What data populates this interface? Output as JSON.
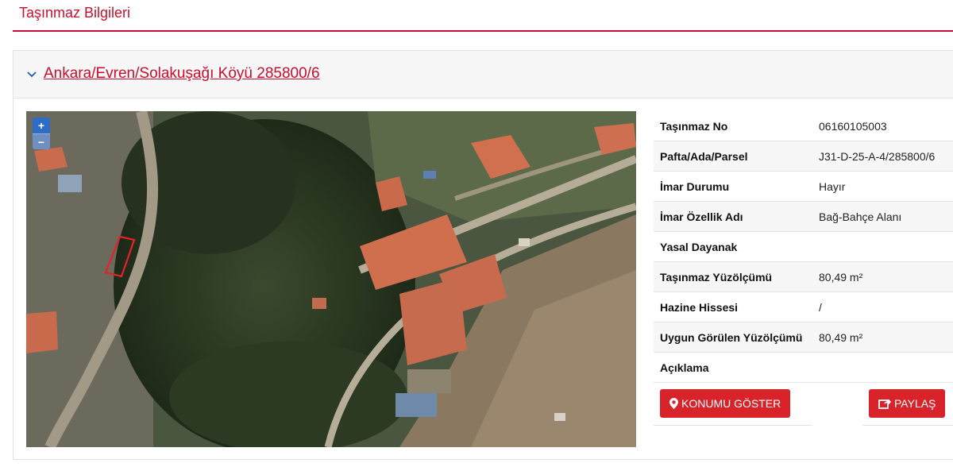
{
  "page": {
    "title": "Taşınmaz Bilgileri"
  },
  "panel": {
    "link": "Ankara/Evren/Solakuşağı Köyü 285800/6",
    "icons": {
      "chevron": "chevron-down-icon"
    }
  },
  "map": {
    "zoom_in": "+",
    "zoom_out": "−",
    "parcel_color": "#e3232c"
  },
  "info": {
    "rows": [
      {
        "label": "Taşınmaz No",
        "value": "06160105003"
      },
      {
        "label": "Pafta/Ada/Parsel",
        "value": "J31-D-25-A-4/285800/6"
      },
      {
        "label": "İmar Durumu",
        "value": "Hayır"
      },
      {
        "label": "İmar Özellik Adı",
        "value": "Bağ-Bahçe Alanı"
      },
      {
        "label": "Yasal Dayanak",
        "value": ""
      },
      {
        "label": "Taşınmaz Yüzölçümü",
        "value": "80,49 m²"
      },
      {
        "label": "Hazine Hissesi",
        "value": "/"
      },
      {
        "label": "Uygun Görülen Yüzölçümü",
        "value": "80,49 m²"
      },
      {
        "label": "Açıklama",
        "value": ""
      }
    ]
  },
  "actions": {
    "show_location": "KONUMU GÖSTER",
    "share": "PAYLAŞ"
  },
  "colors": {
    "accent": "#c8102e",
    "button": "#d8232a",
    "zoom": "#2d6cc7"
  }
}
